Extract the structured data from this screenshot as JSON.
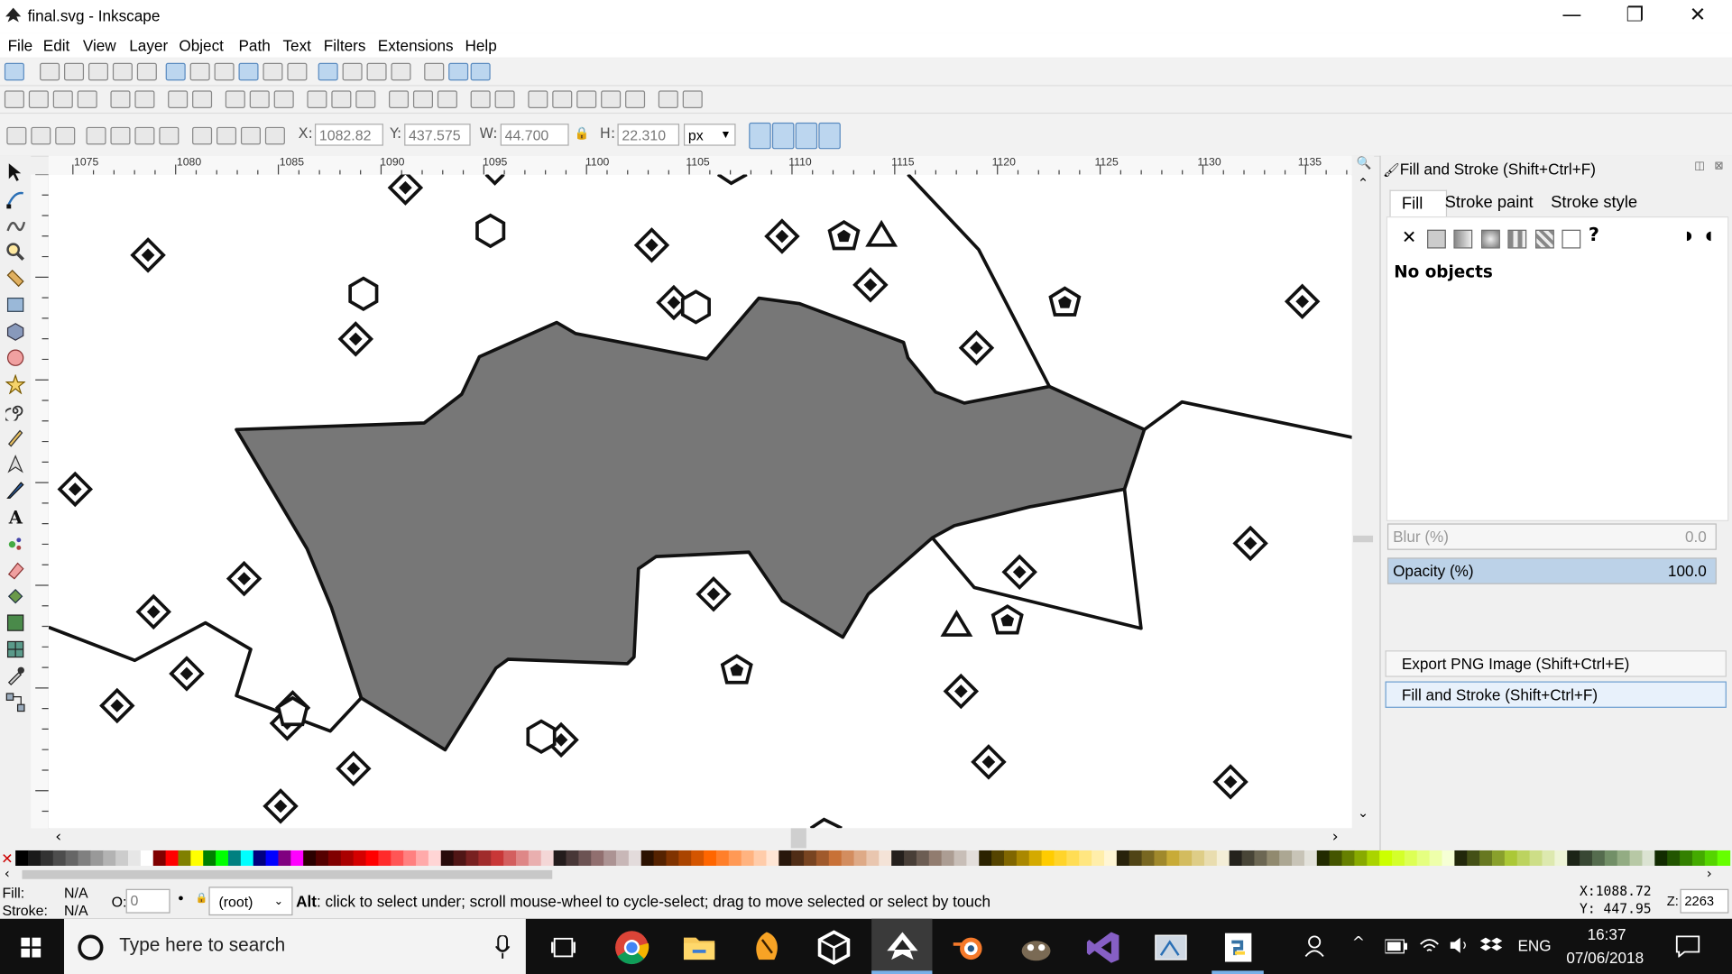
{
  "window": {
    "title": "final.svg - Inkscape",
    "min_glyph": "—",
    "max_glyph": "❐",
    "close_glyph": "✕"
  },
  "menu": [
    "File",
    "Edit",
    "View",
    "Layer",
    "Object",
    "Path",
    "Text",
    "Filters",
    "Extensions",
    "Help"
  ],
  "tool_controls": {
    "x_label": "X:",
    "x_value": "1082.82",
    "y_label": "Y:",
    "y_value": "437.575",
    "w_label": "W:",
    "w_value": "44.700",
    "h_label": "H:",
    "h_value": "22.310",
    "unit": "px"
  },
  "ruler": {
    "labels": [
      "1075",
      "1080",
      "1085",
      "1090",
      "1095",
      "1100",
      "1105",
      "1110",
      "1115",
      "1120",
      "1125",
      "1130",
      "1135"
    ],
    "vertical_labels": [
      "4\n4\n5",
      "4\n4\n0",
      "4\n3\n5",
      "4\n3\n0",
      "4\n2\n5",
      "4\n2\n0",
      "4\n1\n5"
    ]
  },
  "dock": {
    "title": "Fill and Stroke (Shift+Ctrl+F)",
    "tabs": [
      "Fill",
      "Stroke paint",
      "Stroke style"
    ],
    "no_objects": "No objects",
    "blur_label": "Blur (%)",
    "blur_value": "0.0",
    "opacity_label": "Opacity (%)",
    "opacity_value": "100.0",
    "panel_export": "Export PNG Image (Shift+Ctrl+E)",
    "panel_fill": "Fill and Stroke (Shift+Ctrl+F)",
    "unknown_paint": "?",
    "no_paint": "✕"
  },
  "status": {
    "fill_label": "Fill:",
    "fill_value": "N/A",
    "stroke_label": "Stroke:",
    "stroke_value": "N/A",
    "opacity_label": "O:",
    "opacity_value": "0",
    "layer": "(root)",
    "message_key": "Alt",
    "message": ": click to select under; scroll mouse-wheel to cycle-select; drag to move selected or select by touch",
    "cursor_x": "X:1088.72",
    "cursor_y": "Y:  447.95",
    "zoom_label": "Z:",
    "zoom_value": "2263"
  },
  "taskbar": {
    "search_placeholder": "Type here to search",
    "language": "ENG",
    "time": "16:37",
    "date": "07/06/2018"
  },
  "colors": {
    "shape_fill": "#777777",
    "selection_blue": "#bcd6ef",
    "taskbar": "#101010"
  }
}
